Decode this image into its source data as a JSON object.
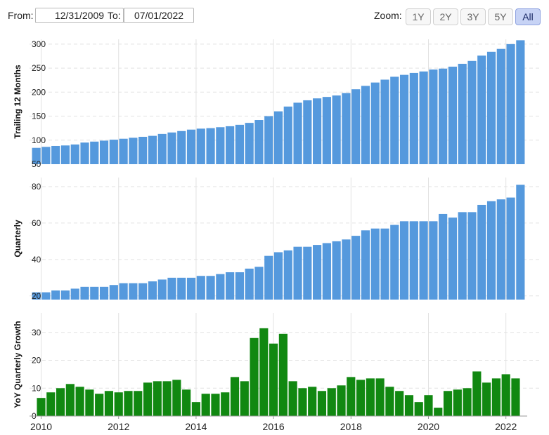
{
  "toolbar": {
    "from_label": "From:",
    "from_value": "12/31/2009",
    "to_label": "To:",
    "to_value": "07/01/2022",
    "zoom_label": "Zoom:",
    "zoom_buttons": [
      "1Y",
      "2Y",
      "3Y",
      "5Y",
      "All"
    ],
    "zoom_active": "All"
  },
  "colors": {
    "ttm_bar": "#5599dd",
    "quarterly_bar": "#5599dd",
    "growth_bar": "#118811",
    "grid": "#e2e2e2"
  },
  "chart_data": [
    {
      "type": "bar",
      "ylabel": "Trailing 12 Months",
      "ylim": [
        50,
        310
      ],
      "yticks": [
        50,
        100,
        150,
        200,
        250,
        300
      ],
      "x": [
        2009.875,
        2010.125,
        2010.375,
        2010.625,
        2010.875,
        2011.125,
        2011.375,
        2011.625,
        2011.875,
        2012.125,
        2012.375,
        2012.625,
        2012.875,
        2013.125,
        2013.375,
        2013.625,
        2013.875,
        2014.125,
        2014.375,
        2014.625,
        2014.875,
        2015.125,
        2015.375,
        2015.625,
        2015.875,
        2016.125,
        2016.375,
        2016.625,
        2016.875,
        2017.125,
        2017.375,
        2017.625,
        2017.875,
        2018.125,
        2018.375,
        2018.625,
        2018.875,
        2019.125,
        2019.375,
        2019.625,
        2019.875,
        2020.125,
        2020.375,
        2020.625,
        2020.875,
        2021.125,
        2021.375,
        2021.625,
        2021.875,
        2022.125,
        2022.375
      ],
      "values": [
        84,
        86,
        88,
        89,
        91,
        95,
        97,
        99,
        101,
        103,
        105,
        107,
        109,
        113,
        116,
        119,
        122,
        124,
        125,
        127,
        129,
        132,
        136,
        142,
        150,
        160,
        170,
        178,
        183,
        187,
        190,
        193,
        198,
        206,
        213,
        220,
        226,
        232,
        236,
        240,
        243,
        247,
        249,
        253,
        259,
        265,
        276,
        284,
        290,
        300,
        308
      ]
    },
    {
      "type": "bar",
      "ylabel": "Quarterly",
      "ylim": [
        18,
        85
      ],
      "yticks": [
        20,
        40,
        60,
        80
      ],
      "x": [
        2009.875,
        2010.125,
        2010.375,
        2010.625,
        2010.875,
        2011.125,
        2011.375,
        2011.625,
        2011.875,
        2012.125,
        2012.375,
        2012.625,
        2012.875,
        2013.125,
        2013.375,
        2013.625,
        2013.875,
        2014.125,
        2014.375,
        2014.625,
        2014.875,
        2015.125,
        2015.375,
        2015.625,
        2015.875,
        2016.125,
        2016.375,
        2016.625,
        2016.875,
        2017.125,
        2017.375,
        2017.625,
        2017.875,
        2018.125,
        2018.375,
        2018.625,
        2018.875,
        2019.125,
        2019.375,
        2019.625,
        2019.875,
        2020.125,
        2020.375,
        2020.625,
        2020.875,
        2021.125,
        2021.375,
        2021.625,
        2021.875,
        2022.125,
        2022.375
      ],
      "values": [
        22,
        22,
        23,
        23,
        24,
        25,
        25,
        25,
        26,
        27,
        27,
        27,
        28,
        29,
        30,
        30,
        30,
        31,
        31,
        32,
        33,
        33,
        35,
        36,
        42,
        44,
        45,
        47,
        47,
        48,
        49,
        50,
        51,
        53,
        56,
        57,
        57,
        59,
        61,
        61,
        61,
        61,
        65,
        63,
        66,
        66,
        70,
        72,
        73,
        74,
        81
      ]
    },
    {
      "type": "bar",
      "ylabel": "YoY Quarterly Growth",
      "ylim": [
        0,
        37
      ],
      "yticks": [
        0,
        10,
        20,
        30
      ],
      "xlim": [
        2009.7,
        2022.55
      ],
      "xticks": [
        2010,
        2012,
        2014,
        2016,
        2018,
        2020,
        2022
      ],
      "x": [
        2010.0,
        2010.25,
        2010.5,
        2010.75,
        2011.0,
        2011.25,
        2011.5,
        2011.75,
        2012.0,
        2012.25,
        2012.5,
        2012.75,
        2013.0,
        2013.25,
        2013.5,
        2013.75,
        2014.0,
        2014.25,
        2014.5,
        2014.75,
        2015.0,
        2015.25,
        2015.5,
        2015.75,
        2016.0,
        2016.25,
        2016.5,
        2016.75,
        2017.0,
        2017.25,
        2017.5,
        2017.75,
        2018.0,
        2018.25,
        2018.5,
        2018.75,
        2019.0,
        2019.25,
        2019.5,
        2019.75,
        2020.0,
        2020.25,
        2020.5,
        2020.75,
        2021.0,
        2021.25,
        2021.5,
        2021.75,
        2022.0,
        2022.25
      ],
      "values": [
        6.5,
        8.5,
        10,
        11.5,
        10.5,
        9.5,
        8,
        9,
        8.5,
        9,
        9,
        12,
        12.5,
        12.5,
        13,
        9.5,
        5,
        8,
        8,
        8.5,
        14,
        12.5,
        28,
        31.5,
        26,
        29.5,
        12.5,
        10,
        10.5,
        9,
        10,
        11,
        14,
        13,
        13.5,
        13.5,
        10.5,
        9,
        7.5,
        5,
        7.5,
        3,
        9,
        9.5,
        10,
        16,
        12,
        13.5,
        15,
        13.5
      ]
    }
  ]
}
